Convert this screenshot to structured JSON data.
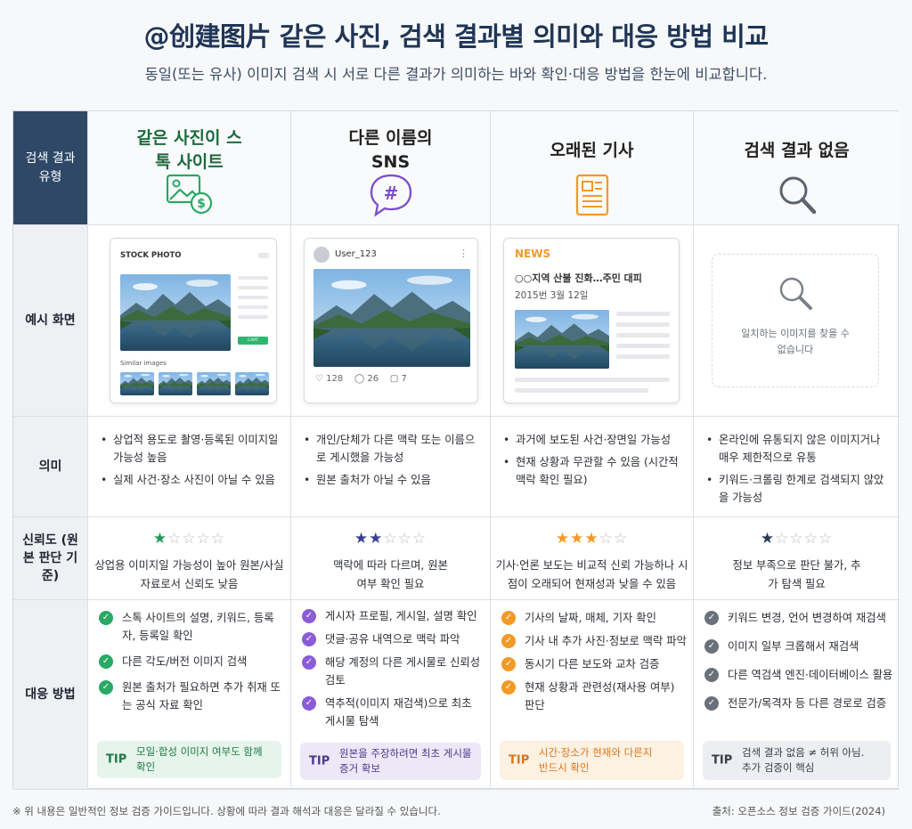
{
  "title": "@创建图片 같은 사진, 검색 결과별 의미와 대응 방법 비교",
  "subtitle": "동일(또는 유사) 이미지 검색 시 서로 다른 결과가 의미하는 바와 확인·대응 방법을 한눈에 비교합니다.",
  "row_heads": {
    "type": "검색 결과 유형",
    "example": "예시 화면",
    "meaning": "의미",
    "reliability": "신뢰도 (원본 판단 기준)",
    "response": "대응 방법"
  },
  "columns": [
    {
      "header": "같은 사진이 스톡 사이트",
      "icon": "image-dollar-icon",
      "accent": "#2aa866",
      "example": {
        "site_label": "STOCK PHOTO",
        "button_label": "CART",
        "similar_label": "Similar images"
      },
      "meaning": [
        "상업적 용도로 촬영·등록된 이미지일 가능성 높음",
        "실제 사건·장소 사진이 아닐 수 있음"
      ],
      "stars": "1",
      "reliability_text": "상업용 이미지일 가능성이 높아 원본/사실 자료로서 신뢰도 낮음",
      "response": [
        "스톡 사이트의 설명, 키워드, 등록자, 등록일 확인",
        "다른 각도/버전 이미지 검색",
        "원본 출처가 필요하면 추가 취재 또는 공식 자료 확인"
      ],
      "tip_label": "TIP",
      "tip": "모일·합성 이미지 여부도 함께 확인",
      "tip_bg": "#e6f4ec",
      "tip_color": "#1f7a45"
    },
    {
      "header": "다른 이름의 SNS",
      "icon": "hashtag-bubble-icon",
      "accent": "#7c4dcc",
      "example": {
        "username": "User_123",
        "likes": "128",
        "comments": "26",
        "shares": "7"
      },
      "meaning": [
        "개인/단체가 다른 맥락 또는 이름으로 게시했을 가능성",
        "원본 출처가 아닐 수 있음"
      ],
      "stars": "2",
      "reliability_text": "맥락에 따라 다르며, 원본 여부 확인 필요",
      "response": [
        "게시자 프로필, 게시일, 설명 확인",
        "댓글·공유 내역으로 맥락 파악",
        "해당 계정의 다른 게시물로 신뢰성 검토",
        "역추적(이미지 재검색)으로 최초 게시물 탐색"
      ],
      "tip_label": "TIP",
      "tip": "원본을 주장하려면 최초 게시물 증거 확보",
      "tip_bg": "#ece8f8",
      "tip_color": "#4a3a8c"
    },
    {
      "header": "오래된 기사",
      "icon": "newspaper-icon",
      "accent": "#f29a25",
      "example": {
        "news_label": "NEWS",
        "headline": "○○지역 산불 진화…주민 대피",
        "date": "2015번 3월 12일"
      },
      "meaning": [
        "과거에 보도된 사건·장면일 가능성",
        "현재 상황과 무관할 수 있음 (시간적 맥락 확인 필요)"
      ],
      "stars": "3",
      "reliability_text": "기사·언론 보도는 비교적 신뢰 가능하나 시점이 오래되어 현재성과 낮을 수 있음",
      "response": [
        "기사의 날짜, 매체, 기자 확인",
        "기사 내 추가 사진·정보로 맥락 파악",
        "동시기 다른 보도와 교차 검증",
        "현재 상황과 관련성(재사용 여부) 판단"
      ],
      "tip_label": "TIP",
      "tip": "시간·장소가 현재와 다른지 반드시 확인",
      "tip_bg": "#fdf1e2",
      "tip_color": "#d9771a"
    },
    {
      "header": "검색 결과 없음",
      "icon": "magnifier-icon",
      "accent": "#5d6470",
      "example": {
        "empty_text": "일치하는 이미지를 찾을 수 없습니다"
      },
      "meaning": [
        "온라인에 유통되지 않은 이미지거나 매우 제한적으로 유통",
        "키워드·크롤링 한계로 검색되지 않았을 가능성"
      ],
      "stars": "1",
      "reliability_text": "정보 부족으로 판단 불가, 추가 탐색 필요",
      "response": [
        "키워드 변경, 언어 변경하여 재검색",
        "이미지 일부 크롭해서 재검색",
        "다른 역검색 엔진·데이터베이스 활용",
        "전문가/목격자 등 다른 경로로 검증"
      ],
      "tip_label": "TIP",
      "tip": "검색 결과 없음 ≠ 허위 아님. 추가 검증이 핵심",
      "tip_bg": "#eceef1",
      "tip_color": "#3a3f48"
    }
  ],
  "footer_note": "※ 위 내용은 일반적인 정보 검증 가이드입니다. 상황에 따라 결과 해석과 대응은 달라질 수 있습니다.",
  "footer_source": "출처: 오픈소스 정보 검증 가이드(2024)"
}
